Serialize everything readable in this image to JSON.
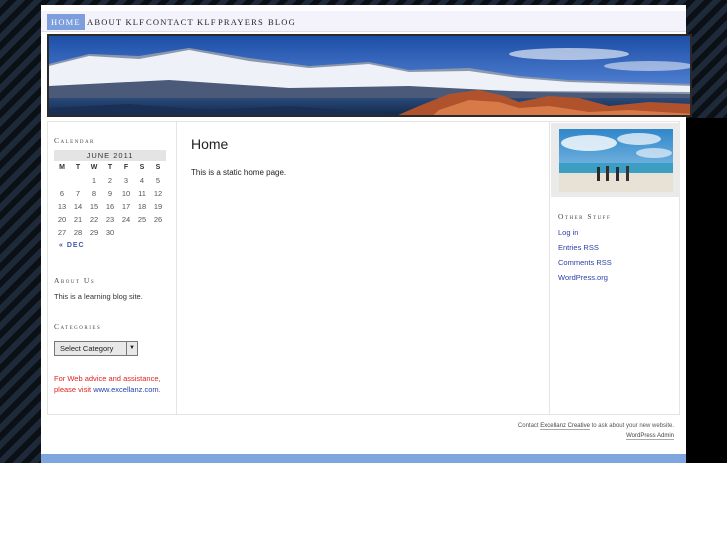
{
  "nav": {
    "items": [
      {
        "label": "HOME",
        "active": true
      },
      {
        "label": "ABOUT KLF"
      },
      {
        "label": "CONTACT KLF"
      },
      {
        "label": "PRAYERS"
      },
      {
        "label": "BLOG"
      }
    ]
  },
  "sidebar": {
    "calendar": {
      "title": "Calendar",
      "caption": "JUNE 2011",
      "days": [
        "M",
        "T",
        "W",
        "T",
        "F",
        "S",
        "S"
      ],
      "weeks": [
        [
          "",
          "",
          "1",
          "2",
          "3",
          "4",
          "5"
        ],
        [
          "6",
          "7",
          "8",
          "9",
          "10",
          "11",
          "12"
        ],
        [
          "13",
          "14",
          "15",
          "16",
          "17",
          "18",
          "19"
        ],
        [
          "20",
          "21",
          "22",
          "23",
          "24",
          "25",
          "26"
        ],
        [
          "27",
          "28",
          "29",
          "30",
          "",
          "",
          ""
        ]
      ],
      "prev_link": "« DEC"
    },
    "about": {
      "title": "About Us",
      "text": "This is a learning blog site."
    },
    "categories": {
      "title": "Categories",
      "selected": "Select Category"
    },
    "advice": {
      "text_line1": "For Web advice and assistance,",
      "text_prefix": "please visit ",
      "link": "www.excellanz.com",
      "text_suffix": "."
    }
  },
  "main": {
    "title": "Home",
    "text": "This is a static home page."
  },
  "right_sidebar": {
    "other_title": "Other Stuff",
    "links": [
      "Log in",
      "Entries RSS",
      "Comments RSS",
      "WordPress.org"
    ]
  },
  "footer": {
    "line1_prefix": "Contact ",
    "line1_link": "Excellanz Creative",
    "line1_suffix": " to ask about your new website.",
    "line2_link": "WordPress Admin"
  },
  "colors": {
    "nav_active": "#7d9edc",
    "link": "#2a3fa8",
    "advice": "#e0241f",
    "bottom_bar": "#7ea6de"
  }
}
